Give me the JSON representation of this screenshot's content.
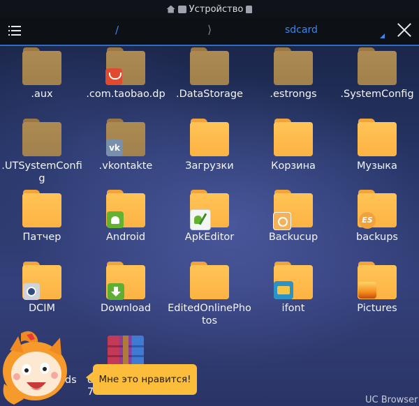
{
  "status_bar": {
    "title": "Устройство"
  },
  "toolbar": {
    "menu_icon": "hamburger-menu-icon",
    "path_root": "/",
    "path_separator": "⟩",
    "current_dir": "sdcard",
    "close_icon": "close-icon"
  },
  "files": [
    {
      "name": ".aux",
      "hidden": true
    },
    {
      "name": ".com.taobao.dp",
      "hidden": true,
      "badge": "taobao-icon"
    },
    {
      "name": ".DataStorage",
      "hidden": true
    },
    {
      "name": ".estrongs",
      "hidden": true
    },
    {
      "name": ".SystemConfig",
      "hidden": true
    },
    {
      "name": ".UTSystemConfi\ng",
      "hidden": true
    },
    {
      "name": ".vkontakte",
      "hidden": true,
      "badge": "vk-icon",
      "badge_text": "vk"
    },
    {
      "name": "Загрузки"
    },
    {
      "name": "Корзина"
    },
    {
      "name": "Музыка"
    },
    {
      "name": "Патчер"
    },
    {
      "name": "Android",
      "badge": "android-icon"
    },
    {
      "name": "ApkEditor",
      "badge": "apk-editor-icon"
    },
    {
      "name": "Backucup",
      "badge": "backup-icon"
    },
    {
      "name": "backups",
      "badge": "es-icon",
      "badge_text": "ES"
    },
    {
      "name": "DCIM",
      "badge": "camera-icon"
    },
    {
      "name": "Download",
      "badge": "download-icon"
    },
    {
      "name": "EditedOnlinePho\ntos"
    },
    {
      "name": "ifont",
      "badge": "ifont-icon"
    },
    {
      "name": "Pictures",
      "badge": "pictures-icon"
    }
  ],
  "partial_row": {
    "label_left": "ads",
    "archive_label_top": "d",
    "archive_label_bottom": "7445255552e2e1"
  },
  "toast": {
    "text": "Мне это нравится!"
  },
  "watermark": "UC Browser",
  "colors": {
    "accent": "#3f86e6",
    "folder": "#fcb343",
    "toast": "#fbbd3a"
  }
}
